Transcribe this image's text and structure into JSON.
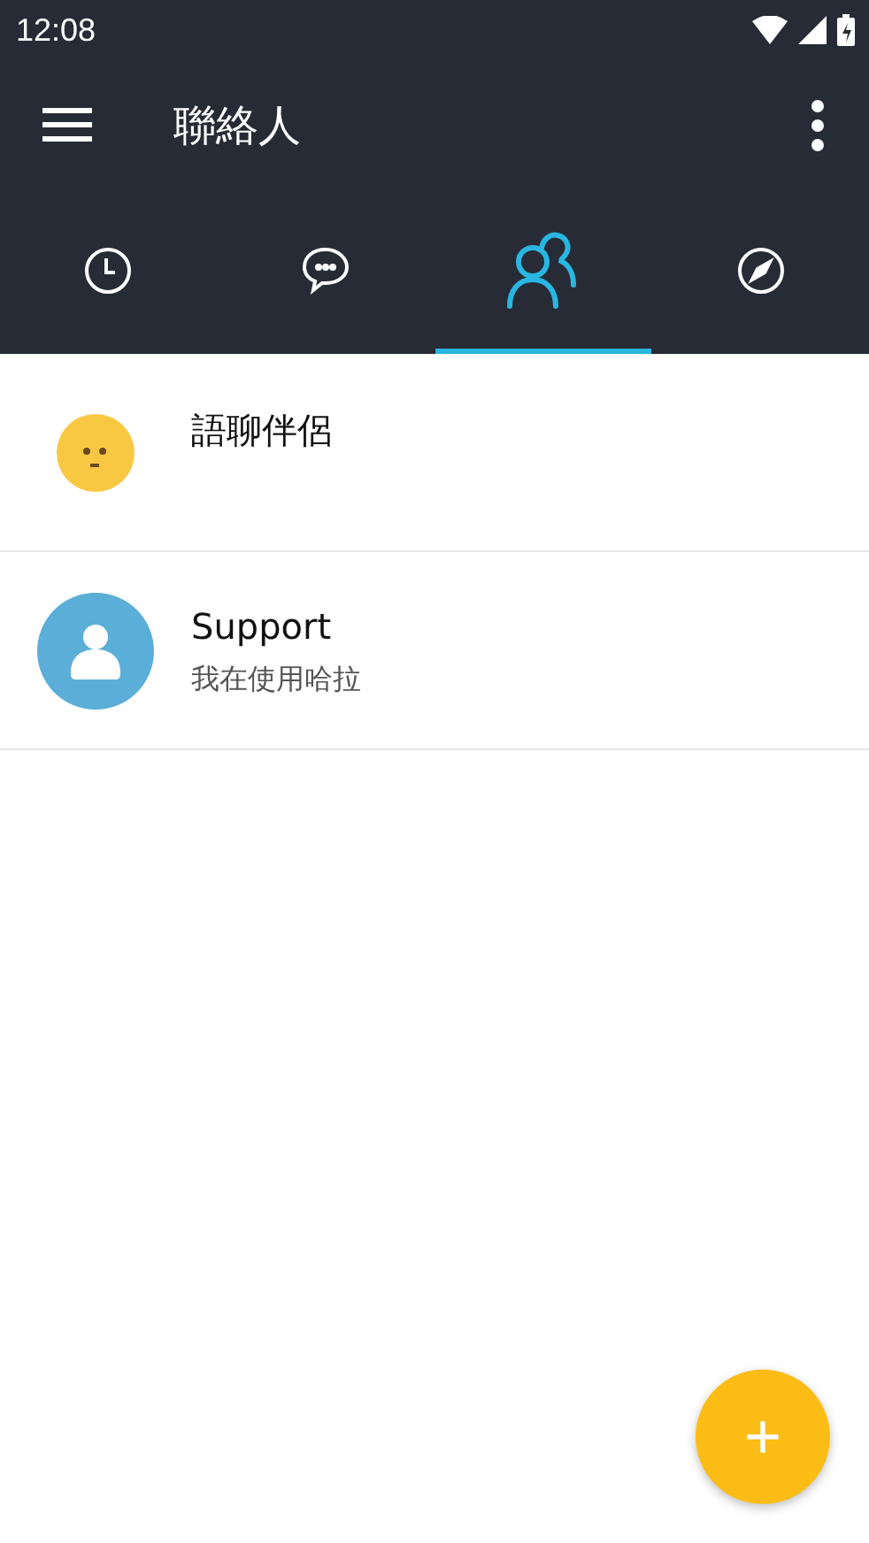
{
  "status_bar": {
    "time": "12:08"
  },
  "app_bar": {
    "title": "聯絡人"
  },
  "tabs": [
    {
      "kind": "clock",
      "selected": false
    },
    {
      "kind": "chat",
      "selected": false
    },
    {
      "kind": "people",
      "selected": true
    },
    {
      "kind": "compass",
      "selected": false
    }
  ],
  "contacts": [
    {
      "kind": "smiley",
      "name": "語聊伴侶"
    },
    {
      "kind": "person",
      "name": "Support",
      "status": "我在使用哈拉"
    }
  ],
  "fab": {
    "label": "+"
  }
}
